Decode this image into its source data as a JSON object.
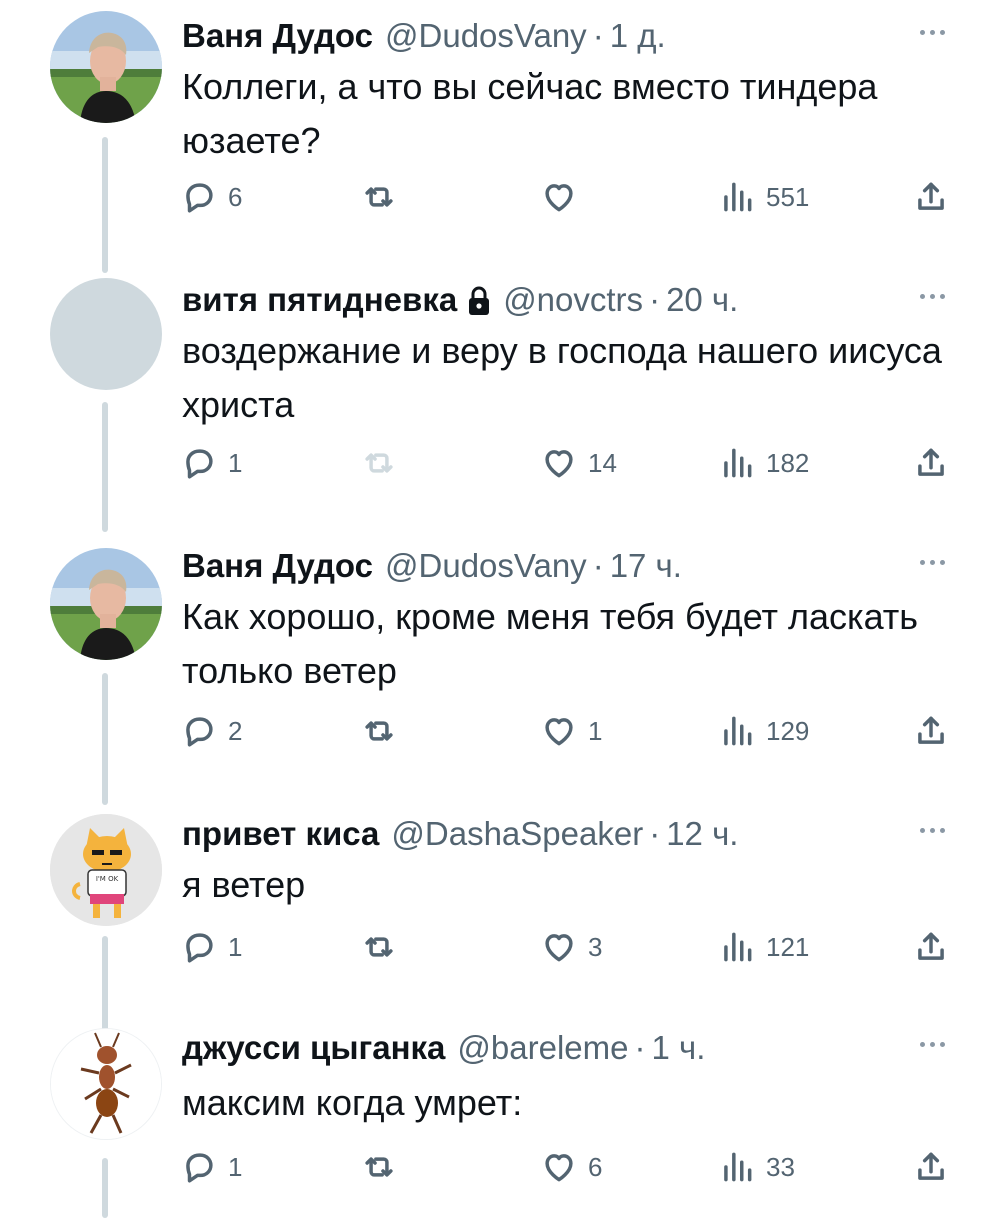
{
  "tweets": [
    {
      "name": "Ваня Дудос",
      "locked": false,
      "handle": "@DudosVany",
      "time": "1 д.",
      "text": "Коллеги, а что вы сейчас вместо тиндера юзаете?",
      "replies": "6",
      "retweets": "",
      "likes": "",
      "views": "551",
      "avatar": "photo-avatar"
    },
    {
      "name": "витя пятидневка",
      "locked": true,
      "handle": "@novctrs",
      "time": "20 ч.",
      "text": "воздержание и веру в господа нашего иисуса христа",
      "replies": "1",
      "retweets": "",
      "likes": "14",
      "views": "182",
      "avatar": "default-avatar"
    },
    {
      "name": "Ваня Дудос",
      "locked": false,
      "handle": "@DudosVany",
      "time": "17 ч.",
      "text": "Как хорошо, кроме меня тебя будет ласкать только ветер",
      "replies": "2",
      "retweets": "",
      "likes": "1",
      "views": "129",
      "avatar": "photo-avatar"
    },
    {
      "name": "привет киса",
      "locked": false,
      "handle": "@DashaSpeaker",
      "time": "12 ч.",
      "text": "я ветер",
      "replies": "1",
      "retweets": "",
      "likes": "3",
      "views": "121",
      "avatar": "cat-avatar",
      "avatar_caption": "I'M OK"
    },
    {
      "name": "джусси цыганка",
      "locked": false,
      "handle": "@bareleme",
      "time": "1 ч.",
      "text": "максим когда умрет:",
      "replies": "1",
      "retweets": "",
      "likes": "6",
      "views": "33",
      "avatar": "ant-avatar"
    }
  ],
  "separator": "·",
  "icons": [
    "reply-icon",
    "retweet-icon",
    "like-icon",
    "views-icon",
    "share-icon",
    "more-icon",
    "lock-icon"
  ],
  "colors": {
    "text": "#0f1419",
    "secondary": "#536471",
    "line": "#cfd9de",
    "default_avatar": "#cfd9de"
  }
}
